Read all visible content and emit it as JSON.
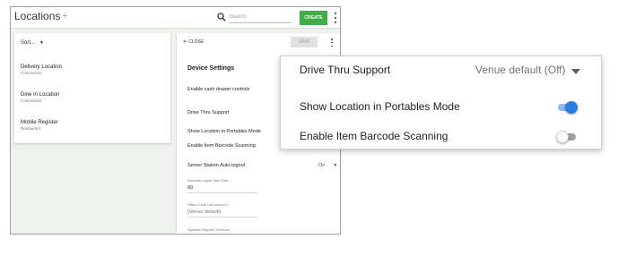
{
  "header": {
    "title": "Locations",
    "add_icon": "plus-icon",
    "search_placeholder": "Search",
    "create_label": "CREATE"
  },
  "list": {
    "sort_label": "Sort...",
    "items": [
      {
        "name": "Delivery Location",
        "type": "Concession"
      },
      {
        "name": "Dine In Location",
        "type": "Concession"
      },
      {
        "name": "Mobile Register",
        "type": "Restaurant"
      }
    ]
  },
  "detail": {
    "close_label": "CLOSE",
    "save_label": "SAVE",
    "section_title": "Device Settings",
    "enable_cash_drawer": "Enable cash drawer controls",
    "drive_thru_support": "Drive Thru Support",
    "drive_thru_value_partial": "V",
    "show_location_portables": "Show Location in Portables Mode",
    "enable_item_barcode": "Enable Item Barcode Scanning",
    "server_station_autologout": "Server Station Auto-logout",
    "server_station_value": "On",
    "auto_logout_label": "Automatic Logout Time Thres...",
    "auto_logout_value": "60",
    "offline_cc_label": "Offline Credit Card Amount Li...",
    "offline_cc_value": "(Venue default)",
    "signature_label": "Signature Required Threshold..."
  },
  "zoom": {
    "drive_thru_label": "Drive Thru Support",
    "drive_thru_value": "Venue default (Off)",
    "show_location_label": "Show Location in Portables Mode",
    "show_location_enabled": true,
    "barcode_label": "Enable Item Barcode Scanning",
    "barcode_enabled": false
  },
  "colors": {
    "create_button": "#3fae49",
    "toggle_on": "#2b7be4",
    "toggle_on_track": "#90b8f0",
    "toggle_off_track": "#9e9e9e",
    "app_background": "#eef2ec"
  }
}
